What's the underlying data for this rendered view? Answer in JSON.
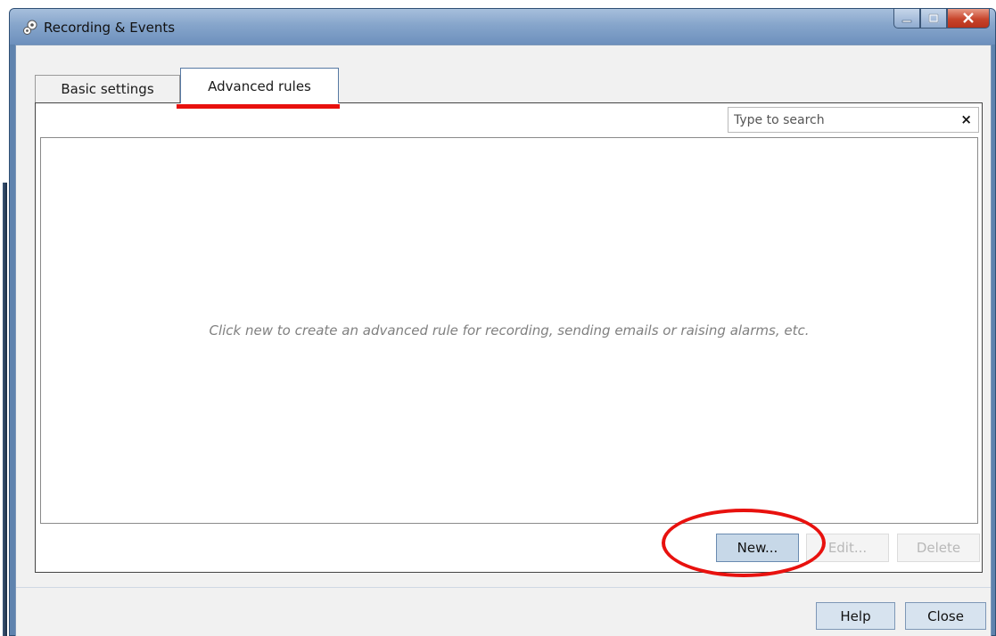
{
  "window": {
    "title": "Recording & Events",
    "controls": [
      "minimize",
      "maximize",
      "close"
    ]
  },
  "tabs": [
    {
      "label": "Basic settings",
      "active": false
    },
    {
      "label": "Advanced rules",
      "active": true
    }
  ],
  "search": {
    "placeholder": "Type to search",
    "clear_icon": "×"
  },
  "rules_list": {
    "empty_message": "Click new to create an advanced rule for recording, sending emails or raising alarms, etc."
  },
  "actions": {
    "new_label": "New...",
    "edit_label": "Edit...",
    "delete_label": "Delete"
  },
  "footer": {
    "help_label": "Help",
    "close_label": "Close"
  },
  "colors": {
    "highlight": "#e8110e",
    "title_bar": "#86a5cb",
    "primary_button": "#c7d8e8"
  },
  "icons": {
    "app": "gear-cluster-icon",
    "minimize": "minimize-icon",
    "maximize": "maximize-icon",
    "close": "close-icon"
  }
}
